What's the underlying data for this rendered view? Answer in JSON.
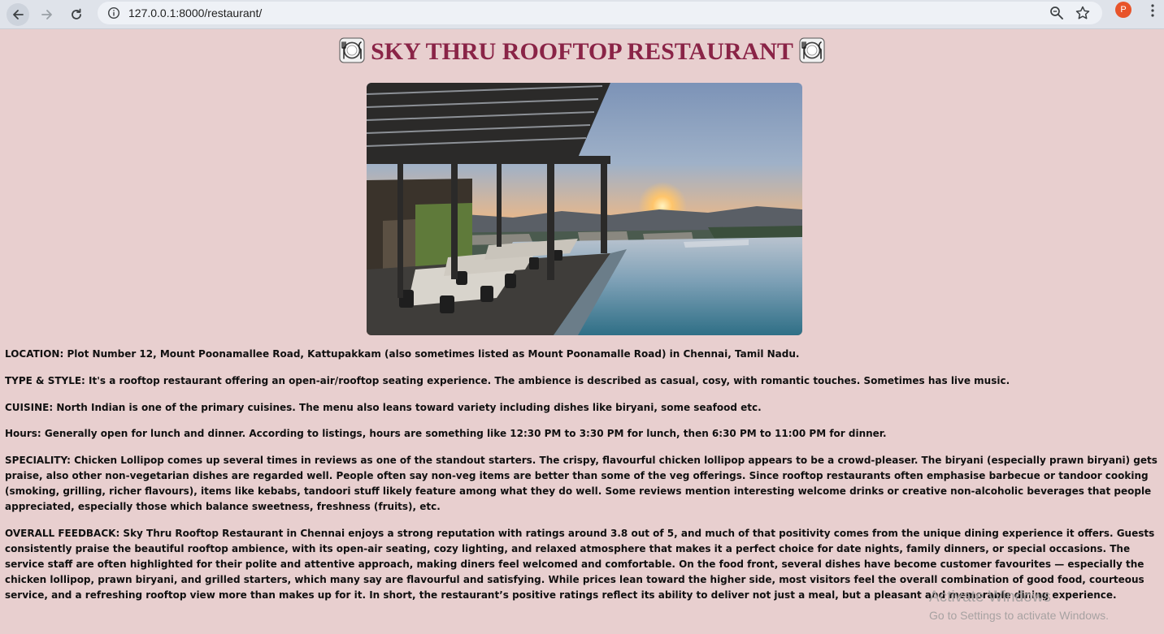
{
  "browser": {
    "url": "127.0.0.1:8000/restaurant/",
    "profile_initial": "P",
    "icons": [
      "back-arrow-icon",
      "forward-arrow-icon",
      "reload-icon",
      "info-icon",
      "zoom-icon",
      "star-icon",
      "more-vert-icon"
    ]
  },
  "page": {
    "title": "SKY THRU ROOFTOP RESTAURANT",
    "title_icon": "plate-cutlery-icon",
    "hero_image": "rooftop-restaurant-pool-sunset",
    "paragraphs": [
      "LOCATION: Plot Number 12, Mount Poonamallee Road, Kattupakkam (also sometimes listed as Mount Poonamalle Road) in Chennai, Tamil Nadu.",
      "TYPE & STYLE: It's a rooftop restaurant offering an open-air/rooftop seating experience. The ambience is described as casual, cosy, with romantic touches. Sometimes has live music.",
      "CUISINE: North Indian is one of the primary cuisines. The menu also leans toward variety including dishes like biryani, some seafood etc.",
      "Hours: Generally open for lunch and dinner. According to listings, hours are something like 12:30 PM to 3:30 PM for lunch, then 6:30 PM to 11:00 PM for dinner.",
      "SPECIALITY: Chicken Lollipop comes up several times in reviews as one of the standout starters. The crispy, flavourful chicken lollipop appears to be a crowd-pleaser. The biryani (especially prawn biryani) gets praise, also other non-vegetarian dishes are regarded well. People often say non-veg items are better than some of the veg offerings. Since rooftop restaurants often emphasise barbecue or tandoor cooking (smoking, grilling, richer flavours), items like kebabs, tandoori stuff likely feature among what they do well. Some reviews mention interesting welcome drinks or creative non-alcoholic beverages that people appreciated, especially those which balance sweetness, freshness (fruits), etc.",
      "OVERALL FEEDBACK: Sky Thru Rooftop Restaurant in Chennai enjoys a strong reputation with ratings around 3.8 out of 5, and much of that positivity comes from the unique dining experience it offers. Guests consistently praise the beautiful rooftop ambience, with its open-air seating, cozy lighting, and relaxed atmosphere that makes it a perfect choice for date nights, family dinners, or special occasions. The service staff are often highlighted for their polite and attentive approach, making diners feel welcomed and comfortable. On the food front, several dishes have become customer favourites — especially the chicken lollipop, prawn biryani, and grilled starters, which many say are flavourful and satisfying. While prices lean toward the higher side, most visitors feel the overall combination of good food, courteous service, and a refreshing rooftop view more than makes up for it. In short, the restaurant’s positive ratings reflect its ability to deliver not just a meal, but a pleasant and memorable dining experience."
    ]
  },
  "watermark": {
    "title": "Activate Windows",
    "subtitle": "Go to Settings to activate Windows."
  },
  "colors": {
    "page_background": "#e8cfcf",
    "title_color": "#8a2447",
    "chrome_background": "#dfe3ea",
    "avatar_color": "#e8542a"
  }
}
